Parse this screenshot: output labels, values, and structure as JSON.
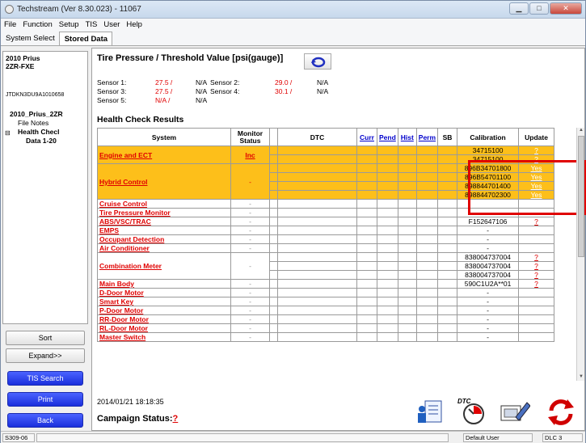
{
  "window": {
    "title": "Techstream (Ver 8.30.023) - 11067",
    "min": "▁",
    "max": "□",
    "close": "✕"
  },
  "menu": [
    "File",
    "Function",
    "Setup",
    "TIS",
    "User",
    "Help"
  ],
  "tabs": [
    "System Select",
    "Stored Data"
  ],
  "vehicle": {
    "year_model": "2010 Prius",
    "engine": "2ZR-FXE",
    "vin": "JTDKN3DU9A1010658",
    "tree_root": "2010_Prius_2ZR",
    "file_notes": "File Notes",
    "health_check": "Health Checl",
    "data": "Data 1-20",
    "expander": "⊟"
  },
  "sidebar_buttons": {
    "sort": "Sort",
    "expand": "Expand>>",
    "tis_search": "TIS Search",
    "print": "Print",
    "back": "Back"
  },
  "tire_pressure": {
    "title": "Tire Pressure / Threshold Value [psi(gauge)]",
    "sensors": [
      {
        "label": "Sensor 1:",
        "value": "27.5 /",
        "threshold": "N/A"
      },
      {
        "label": "Sensor 2:",
        "value": "29.0 /",
        "threshold": "N/A"
      },
      {
        "label": "Sensor 3:",
        "value": "27.5 /",
        "threshold": "N/A"
      },
      {
        "label": "Sensor 4:",
        "value": "30.1 /",
        "threshold": "N/A"
      },
      {
        "label": "Sensor 5:",
        "value": "N/A /",
        "threshold": "N/A"
      }
    ]
  },
  "health_check": {
    "title": "Health Check Results",
    "columns": [
      "System",
      "Monitor Status",
      "DTC",
      "Curr",
      "Pend",
      "Hist",
      "Perm",
      "SB",
      "Calibration",
      "Update"
    ],
    "rows": [
      {
        "system": "Engine and ECT",
        "monitor": "Inc",
        "cal": [
          "34715100",
          "34715100"
        ],
        "upd": [
          "?",
          "?"
        ],
        "highlight": true
      },
      {
        "system": "Hybrid Control",
        "monitor": "-",
        "cal": [
          "896B34701800",
          "896B54701100",
          "898844701400",
          "898844702300"
        ],
        "upd": [
          "Yes",
          "Yes",
          "Yes",
          "Yes"
        ],
        "highlight": true
      },
      {
        "system": "Cruise Control",
        "monitor": "-",
        "cal": [
          ""
        ],
        "upd": [
          ""
        ]
      },
      {
        "system": "Tire Pressure Monitor",
        "monitor": "-",
        "cal": [
          "-"
        ],
        "upd": [
          ""
        ]
      },
      {
        "system": "ABS/VSC/TRAC",
        "monitor": "-",
        "cal": [
          "F152647106"
        ],
        "upd": [
          "?"
        ]
      },
      {
        "system": "EMPS",
        "monitor": "-",
        "cal": [
          "-"
        ],
        "upd": [
          ""
        ]
      },
      {
        "system": "Occupant Detection",
        "monitor": "-",
        "cal": [
          "-"
        ],
        "upd": [
          ""
        ]
      },
      {
        "system": "Air Conditioner",
        "monitor": "-",
        "cal": [
          "-"
        ],
        "upd": [
          ""
        ]
      },
      {
        "system": "Combination Meter",
        "monitor": "-",
        "cal": [
          "838004737004",
          "838004737004",
          "838004737004"
        ],
        "upd": [
          "?",
          "?",
          "?"
        ]
      },
      {
        "system": "Main Body",
        "monitor": "-",
        "cal": [
          "590C1U2A**01"
        ],
        "upd": [
          "?"
        ]
      },
      {
        "system": "D-Door Motor",
        "monitor": "-",
        "cal": [
          "-"
        ],
        "upd": [
          ""
        ]
      },
      {
        "system": "Smart Key",
        "monitor": "-",
        "cal": [
          "-"
        ],
        "upd": [
          ""
        ]
      },
      {
        "system": "P-Door Motor",
        "monitor": "-",
        "cal": [
          "-"
        ],
        "upd": [
          ""
        ]
      },
      {
        "system": "RR-Door Motor",
        "monitor": "-",
        "cal": [
          "-"
        ],
        "upd": [
          ""
        ]
      },
      {
        "system": "RL-Door Motor",
        "monitor": "-",
        "cal": [
          "-"
        ],
        "upd": [
          ""
        ]
      },
      {
        "system": "Master Switch",
        "monitor": "-",
        "cal": [
          "-"
        ],
        "upd": [
          ""
        ]
      }
    ]
  },
  "timestamp": "2014/01/21 18:18:35",
  "campaign": {
    "label": "Campaign Status:",
    "value": "?"
  },
  "icons": {
    "dtc_label": "DTC"
  },
  "status": {
    "left": "S309-06",
    "user": "Default User",
    "dlc": "DLC 3"
  }
}
